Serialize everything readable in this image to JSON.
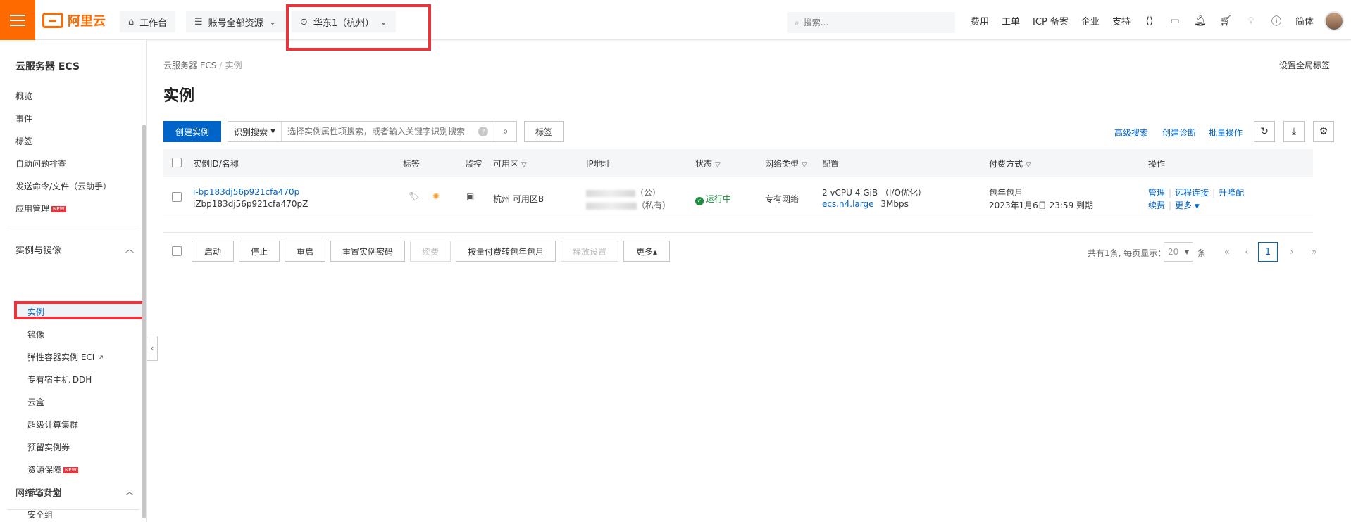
{
  "topbar": {
    "logo_text": "阿里云",
    "workbench": "工作台",
    "resources": "账号全部资源",
    "region": "华东1（杭州）",
    "search_placeholder": "搜索...",
    "links": [
      "费用",
      "工单",
      "ICP 备案",
      "企业",
      "支持"
    ],
    "language": "简体"
  },
  "sidebar": {
    "title": "云服务器 ECS",
    "top_items": [
      "概览",
      "事件",
      "标签",
      "自助问题排查",
      "发送命令/文件（云助手）",
      "应用管理"
    ],
    "new_badge": "NEW",
    "group1": "实例与镜像",
    "group1_items": [
      "实例",
      "镜像",
      "弹性容器实例 ECI",
      "专有宿主机 DDH",
      "云盒",
      "超级计算集群",
      "预留实例券",
      "资源保障",
      "节省计划"
    ],
    "group2": "网络与安全",
    "group2_items": [
      "安全组"
    ]
  },
  "breadcrumb": {
    "root": "云服务器 ECS",
    "separator": "/",
    "current": "实例"
  },
  "global_tag": "设置全局标签",
  "page_title": "实例",
  "toolbar": {
    "create": "创建实例",
    "filter_select": "识别搜索",
    "filter_placeholder": "选择实例属性项搜索，或者输入关键字识别搜索",
    "help": "?",
    "tag_button": "标签",
    "advanced": "高级搜索",
    "diagnose": "创建诊断",
    "batch": "批量操作"
  },
  "table": {
    "headers": [
      "实例ID/名称",
      "标签",
      "监控",
      "可用区",
      "IP地址",
      "状态",
      "网络类型",
      "配置",
      "付费方式",
      "操作"
    ],
    "row": {
      "id": "i-bp183dj56p921cfa470p",
      "name": "iZbp183dj56p921cfa470pZ",
      "zone": "杭州 可用区B",
      "ip_public_suffix": "（公）",
      "ip_private_suffix": "（私有）",
      "status": "运行中",
      "network": "专有网络",
      "config_line1": "2 vCPU 4 GiB （I/O优化）",
      "config_type": "ecs.n4.large",
      "config_bw": "3Mbps",
      "billing_line1": "包年包月",
      "billing_line2": "2023年1月6日 23:59 到期",
      "ops": [
        "管理",
        "远程连接",
        "升降配",
        "续费",
        "更多"
      ]
    }
  },
  "bottom_actions": [
    "启动",
    "停止",
    "重启",
    "重置实例密码",
    "续费",
    "按量付费转包年包月",
    "释放设置",
    "更多▴"
  ],
  "pager": {
    "summary": "共有1条, 每页显示：",
    "page_size": "20",
    "unit": "条",
    "current": "1"
  },
  "colors": {
    "brand": "#ff6a00",
    "primary": "#0064c8",
    "highlight": "#e8343a",
    "success": "#1e8e3e"
  }
}
